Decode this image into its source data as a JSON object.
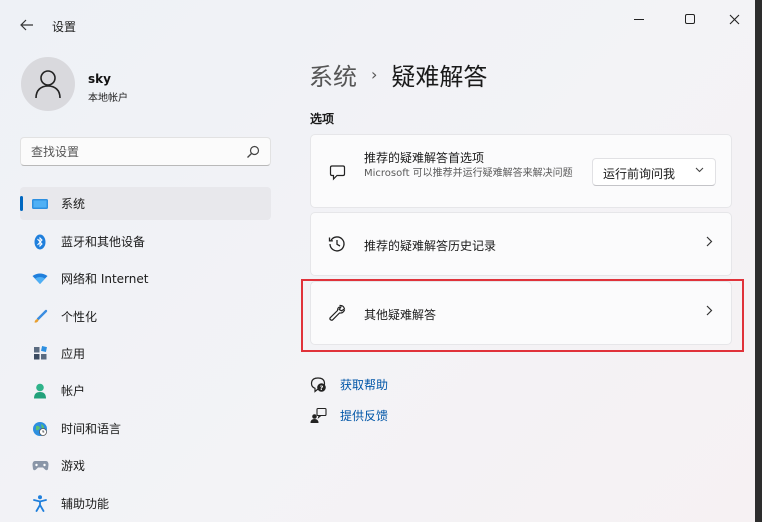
{
  "window": {
    "app_title": "设置"
  },
  "profile": {
    "name": "sky",
    "account_type": "本地帐户"
  },
  "search": {
    "placeholder": "查找设置"
  },
  "sidebar": {
    "items": [
      {
        "label": "系统",
        "icon": "system-icon",
        "active": true
      },
      {
        "label": "蓝牙和其他设备",
        "icon": "bluetooth-icon"
      },
      {
        "label": "网络和 Internet",
        "icon": "wifi-icon"
      },
      {
        "label": "个性化",
        "icon": "brush-icon"
      },
      {
        "label": "应用",
        "icon": "apps-icon"
      },
      {
        "label": "帐户",
        "icon": "account-icon"
      },
      {
        "label": "时间和语言",
        "icon": "globe-clock-icon"
      },
      {
        "label": "游戏",
        "icon": "gamepad-icon"
      },
      {
        "label": "辅助功能",
        "icon": "accessibility-icon"
      }
    ]
  },
  "breadcrumb": {
    "parent": "系统",
    "separator": "›",
    "current": "疑难解答"
  },
  "main": {
    "section_title": "选项",
    "cards": [
      {
        "title": "推荐的疑难解答首选项",
        "description": "Microsoft 可以推荐并运行疑难解答来解决问题",
        "icon": "chat-bubble-icon",
        "dropdown_value": "运行前询问我"
      },
      {
        "title": "推荐的疑难解答历史记录",
        "icon": "history-icon"
      },
      {
        "title": "其他疑难解答",
        "icon": "wrench-icon",
        "highlighted": true
      }
    ],
    "links": [
      {
        "label": "获取帮助",
        "icon": "help-icon"
      },
      {
        "label": "提供反馈",
        "icon": "feedback-icon"
      }
    ]
  },
  "colors": {
    "accent": "#0067c0",
    "link": "#0056a8",
    "highlight": "#e0323a"
  }
}
